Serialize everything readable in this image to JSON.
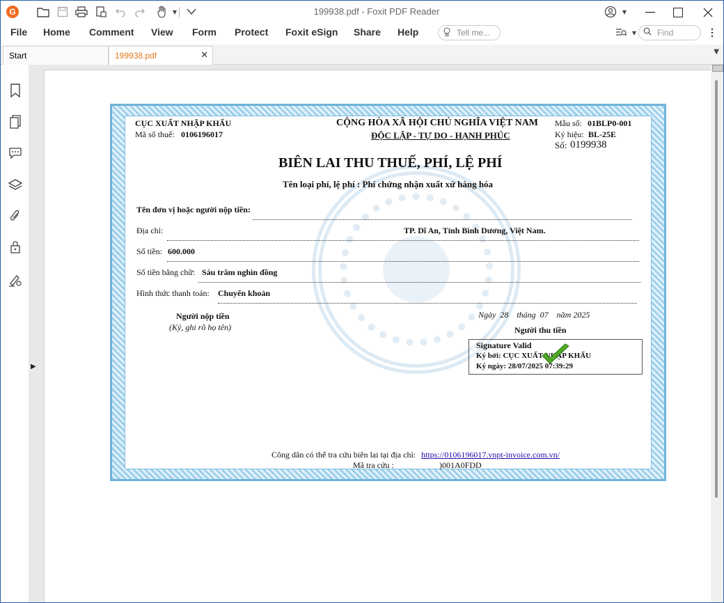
{
  "window": {
    "title": "199938.pdf - Foxit PDF Reader"
  },
  "menu": {
    "items": [
      "File",
      "Home",
      "Comment",
      "View",
      "Form",
      "Protect",
      "Foxit eSign",
      "Share",
      "Help"
    ],
    "tell_me": "Tell me...",
    "find": "Find"
  },
  "tabs": [
    {
      "label": "Start"
    },
    {
      "label": "199938.pdf",
      "active": true
    }
  ],
  "colors": {
    "accent": "#f26b1d",
    "active_tab_text": "#e07a1f",
    "border_blue": "#6fb3d9"
  },
  "left_panel_icons": [
    "bookmark-icon",
    "pages-icon",
    "comments-icon",
    "layers-icon",
    "attachments-icon",
    "security-icon",
    "signature-icon"
  ],
  "receipt": {
    "agency": "CỤC XUẤT NHẬP KHẨU",
    "tax_code_label": "Mã số thuế:",
    "tax_code": "0106196017",
    "republic": "CỘNG HÒA XÃ HỘI CHỦ NGHĨA VIỆT NAM",
    "motto": "ĐỘC LẬP - TỰ DO - HẠNH PHÚC",
    "form_no_label": "Mẫu số:",
    "form_no": "01BLP0-001",
    "symbol_label": "Ký hiệu:",
    "symbol": "BL-25E",
    "number_label": "Số:",
    "number": "0199938",
    "title": "BIÊN LAI THU THUẾ, PHÍ, LỆ PHÍ",
    "fee_type": "Tên loại phí, lệ phí : Phí chứng nhận xuất xứ hàng hóa",
    "payer_label": "Tên đơn vị hoặc người nộp tiền:",
    "address_label": "Địa chỉ:",
    "address_value": "TP. Dĩ An, Tỉnh Bình Dương, Việt Nam.",
    "amount_label": "Số tiền:",
    "amount_value": "600.000",
    "amount_words_label": "Số tiền bằng chữ:",
    "amount_words": "Sáu trăm nghìn đồng",
    "payment_method_label": "Hình thức thanh toán:",
    "payment_method": "Chuyển khoản",
    "payer_sign": "Người nộp tiền",
    "payer_sign_note": "(Ký, ghi rõ họ tên)",
    "date_line": "Ngày  28    tháng  07    năm 2025",
    "collector": "Người thu tiền",
    "sig_valid": "Signature Valid",
    "sig_by": "Ký bởi: CỤC XUẤT NHẬP KHẨU",
    "sig_date": "Ký ngày: 28/07/2025 07:39:29",
    "lookup_text": "Công dân có thể tra cứu biên lai tại địa chỉ:",
    "lookup_url": "https://0106196017.vnpt-invoice.com.vn/",
    "lookup_code_label": "Mã tra cứu :",
    "lookup_code": ")001A0FDD"
  }
}
